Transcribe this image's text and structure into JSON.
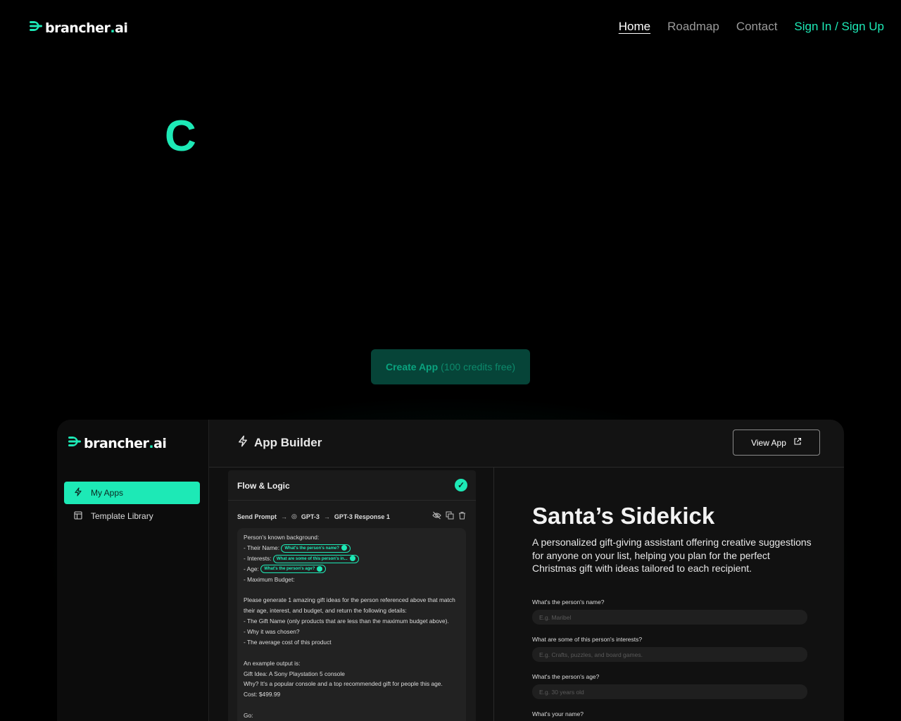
{
  "nav": {
    "brand_main": "brancher",
    "brand_dot": ".",
    "brand_suffix": "ai",
    "links": [
      "Home",
      "Roadmap",
      "Contact"
    ],
    "signin": "Sign In / Sign Up"
  },
  "hero": {
    "letter": "C",
    "cta_bold": "Create App",
    "cta_rest": "(100 credits free)"
  },
  "builder": {
    "sidebar": {
      "items": [
        "My Apps",
        "Template Library"
      ]
    },
    "header_title": "App Builder",
    "view_app": "View App",
    "flow": {
      "title": "Flow & Logic",
      "crumbs": [
        "Send Prompt",
        "GPT-3",
        "GPT-3 Response 1"
      ],
      "lines": [
        "Person's known background:",
        "- Their Name:",
        "- Interests:",
        "- Age:",
        "- Maximum Budget:",
        "",
        "Please generate 1 amazing gift ideas for the person referenced above that match",
        "their age, interest, and budget, and return the following details:",
        "- The Gift Name (only products that are less than the maximum budget above).",
        "- Why it was chosen?",
        "- The average cost of this product",
        "",
        "An example output is:",
        "Gift Idea: A Sony Playstation 5 console",
        "Why? It's a popular console and a top recommended gift for people this age.",
        "Cost: $499.99",
        "",
        "Go:"
      ],
      "chips": [
        "What's the person's age?",
        "What are some of this person's in...",
        "What's the person's name?"
      ]
    },
    "preview": {
      "title": "Santa’s Sidekick",
      "description": "A personalized gift-giving assistant offering creative suggestions for anyone on your list, helping you plan for the perfect Christmas gift with ideas tailored to each recipient.",
      "fields": [
        {
          "label": "What's the person's name?",
          "placeholder": "E.g. Maribel"
        },
        {
          "label": "What are some of this person's interests?",
          "placeholder": "E.g. Crafts, puzzles, and board games."
        },
        {
          "label": "What's the person's age?",
          "placeholder": "E.g. 30 years old"
        },
        {
          "label": "What's your name?",
          "placeholder": ""
        }
      ]
    }
  },
  "colors": {
    "accent": "#1de9b6",
    "background": "#000000"
  }
}
